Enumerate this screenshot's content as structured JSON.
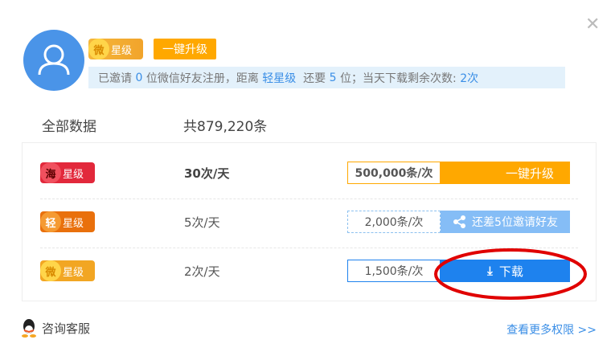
{
  "header": {
    "level_badge": {
      "char": "微",
      "label": "星级"
    },
    "upgrade_label": "一键升级",
    "close_icon": "close-icon",
    "info": {
      "p1": "已邀请 ",
      "invited": "0",
      "p2": " 位微信好友注册，距离 ",
      "target_level": "轻星级",
      "p3": "  还要 ",
      "remaining": "5",
      "p4": " 位；当天下载剩余次数: ",
      "downloads_left": "2次"
    }
  },
  "summary": {
    "label": "全部数据",
    "total": "共879,220条"
  },
  "tiers": [
    {
      "char": "海",
      "label": "星级",
      "rate": "30次/天",
      "quantity": "500,000条/次",
      "action": "一键升级",
      "color": "#e2283b"
    },
    {
      "char": "轻",
      "label": "星级",
      "rate": "5次/天",
      "quantity": "2,000条/次",
      "action": "还差5位邀请好友",
      "color": "#f07a10"
    },
    {
      "char": "微",
      "label": "星级",
      "rate": "2次/天",
      "quantity": "1,500条/次",
      "action": "下载",
      "color": "#f2a623"
    }
  ],
  "footer": {
    "support": "咨询客服",
    "more": "查看更多权限 >>"
  },
  "colors": {
    "accent": "#1e82ee",
    "orange": "#ffa800",
    "annotation": "#e00000"
  }
}
